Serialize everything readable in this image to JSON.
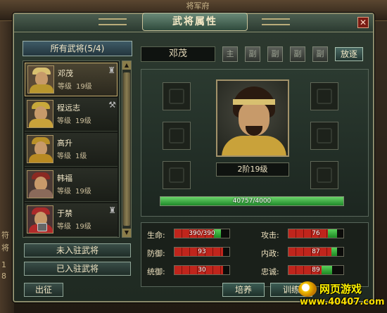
{
  "background": {
    "title": "将军府",
    "left_text": [
      "符",
      "将",
      "1",
      "8"
    ]
  },
  "window": {
    "title": "武将属性",
    "close_label": "✕"
  },
  "general_list": {
    "header": "所有武将(5/4)",
    "items": [
      {
        "name": "邓茂",
        "level_label": "等级",
        "level": "19级",
        "selected": true,
        "locked": false
      },
      {
        "name": "程远志",
        "level_label": "等级",
        "level": "19级",
        "selected": false,
        "locked": false
      },
      {
        "name": "高升",
        "level_label": "等级",
        "level": "1级",
        "selected": false,
        "locked": false
      },
      {
        "name": "韩福",
        "level_label": "等级",
        "level": "19级",
        "selected": false,
        "locked": false
      },
      {
        "name": "于禁",
        "level_label": "等级",
        "level": "19级",
        "selected": false,
        "locked": true
      }
    ],
    "buttons": {
      "not_stationed": "未入驻武将",
      "stationed": "已入驻武将",
      "deploy": "出征"
    }
  },
  "detail": {
    "name": "邓茂",
    "tabs": [
      "主",
      "副",
      "副",
      "副",
      "副"
    ],
    "dismiss": "放逐",
    "rank": "2阶19级",
    "hp": {
      "current": 40757,
      "max": 4000,
      "text": "40757/4000"
    }
  },
  "stats": [
    {
      "label": "生命:",
      "value": "390/390",
      "red": 0.72,
      "green": 0.12
    },
    {
      "label": "攻击:",
      "value": "76",
      "red": 0.72,
      "green": 0.16
    },
    {
      "label": "防御:",
      "value": "93",
      "red": 0.88,
      "green": 0.0
    },
    {
      "label": "内政:",
      "value": "87",
      "red": 0.78,
      "green": 0.1
    },
    {
      "label": "统御:",
      "value": "30",
      "red": 0.88,
      "green": 0.0
    },
    {
      "label": "忠诚:",
      "value": "89",
      "red": 0.6,
      "green": 0.2
    }
  ],
  "actions": {
    "cultivate": "培养",
    "train": "训练"
  },
  "watermark": {
    "line1": "网页游戏",
    "line2": "www.40407.com"
  }
}
